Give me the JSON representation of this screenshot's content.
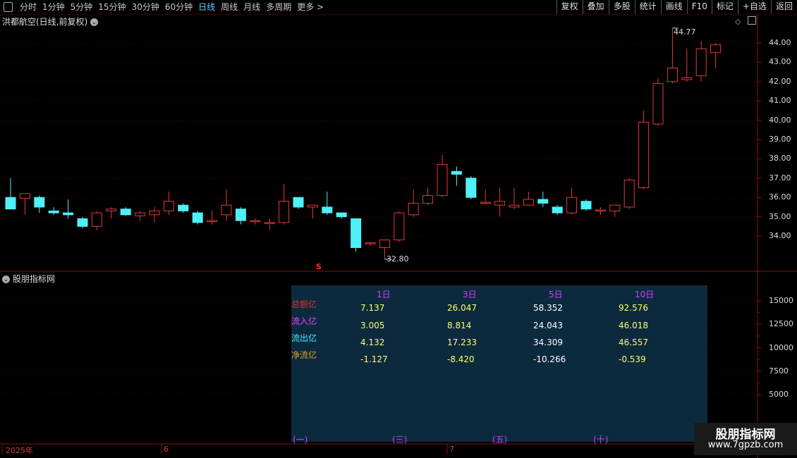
{
  "toolbar": {
    "periods": [
      "分时",
      "1分钟",
      "5分钟",
      "15分钟",
      "30分钟",
      "60分钟",
      "日线",
      "周线",
      "月线",
      "多周期",
      "更多 >"
    ],
    "active_period": "日线",
    "buttons": [
      "复权",
      "叠加",
      "多股",
      "统计",
      "画线",
      "F10",
      "标记",
      "+自选",
      "返回"
    ]
  },
  "stock_title": "洪都航空(日线,前复权)",
  "indicator_title": "股朋指标网",
  "price_axis": [
    "44.00",
    "43.00",
    "42.00",
    "41.00",
    "40.00",
    "39.00",
    "38.00",
    "37.00",
    "36.00",
    "35.00",
    "34.00"
  ],
  "volume_axis": [
    "15000",
    "12500",
    "10000",
    "7500",
    "5000"
  ],
  "annotations": {
    "high": "44.77",
    "low": "32.80",
    "signal": "S"
  },
  "date_labels": [
    "2025年",
    "6",
    "7"
  ],
  "table": {
    "headers": [
      "1日",
      "3日",
      "5日",
      "10日"
    ],
    "rows": [
      {
        "label": "总额亿",
        "color": "#e03030",
        "values": [
          "7.137",
          "26.047",
          "58.352",
          "92.576"
        ]
      },
      {
        "label": "流入亿",
        "color": "#ff3cff",
        "values": [
          "3.005",
          "8.814",
          "24.043",
          "46.018"
        ]
      },
      {
        "label": "流出亿",
        "color": "#3cf0ff",
        "values": [
          "4.132",
          "17.233",
          "34.309",
          "46.557"
        ]
      },
      {
        "label": "净流亿",
        "color": "#e0a020",
        "values": [
          "-1.127",
          "-8.420",
          "-10.266",
          "-0.539"
        ]
      }
    ],
    "group_labels": [
      "(一)",
      "(三)",
      "(五)",
      "(十)"
    ]
  },
  "logo": {
    "line1": "股朋指标网",
    "line2": "www.7gpzb.com"
  },
  "colors": {
    "up": "#e03a3a",
    "down": "#4ff0f8",
    "grid": "#5a0000",
    "total": "#a01010",
    "inflow": "#ff22ff",
    "outflow": "#22f0ff"
  },
  "chart_data": {
    "type": "candlestick",
    "candles": [
      {
        "o": 36.0,
        "h": 37.0,
        "l": 35.8,
        "c": 35.4
      },
      {
        "o": 35.95,
        "h": 36.2,
        "l": 35.1,
        "c": 36.2
      },
      {
        "o": 36.0,
        "h": 36.1,
        "l": 35.2,
        "c": 35.5
      },
      {
        "o": 35.3,
        "h": 35.5,
        "l": 35.1,
        "c": 35.2
      },
      {
        "o": 35.2,
        "h": 35.9,
        "l": 34.9,
        "c": 35.1
      },
      {
        "o": 34.9,
        "h": 35.0,
        "l": 34.4,
        "c": 34.5
      },
      {
        "o": 34.5,
        "h": 35.3,
        "l": 34.3,
        "c": 35.2
      },
      {
        "o": 35.3,
        "h": 35.5,
        "l": 34.9,
        "c": 35.4
      },
      {
        "o": 35.4,
        "h": 35.5,
        "l": 35.05,
        "c": 35.1
      },
      {
        "o": 35.05,
        "h": 35.3,
        "l": 34.8,
        "c": 35.2
      },
      {
        "o": 35.1,
        "h": 35.5,
        "l": 34.7,
        "c": 35.3
      },
      {
        "o": 35.3,
        "h": 36.3,
        "l": 35.1,
        "c": 35.8
      },
      {
        "o": 35.6,
        "h": 35.7,
        "l": 35.2,
        "c": 35.3
      },
      {
        "o": 35.2,
        "h": 35.3,
        "l": 34.6,
        "c": 34.7
      },
      {
        "o": 34.75,
        "h": 35.3,
        "l": 34.6,
        "c": 34.8
      },
      {
        "o": 35.1,
        "h": 36.4,
        "l": 34.8,
        "c": 35.6
      },
      {
        "o": 35.4,
        "h": 35.5,
        "l": 34.6,
        "c": 34.8
      },
      {
        "o": 34.8,
        "h": 34.9,
        "l": 34.6,
        "c": 34.8
      },
      {
        "o": 34.65,
        "h": 34.9,
        "l": 34.3,
        "c": 34.7
      },
      {
        "o": 34.7,
        "h": 36.7,
        "l": 34.6,
        "c": 35.8
      },
      {
        "o": 36.0,
        "h": 36.0,
        "l": 35.4,
        "c": 35.5
      },
      {
        "o": 35.5,
        "h": 35.6,
        "l": 34.9,
        "c": 35.6
      },
      {
        "o": 35.5,
        "h": 36.3,
        "l": 35.1,
        "c": 35.2
      },
      {
        "o": 35.2,
        "h": 35.2,
        "l": 34.9,
        "c": 35.0
      },
      {
        "o": 34.9,
        "h": 34.9,
        "l": 33.2,
        "c": 33.4
      },
      {
        "o": 33.6,
        "h": 33.7,
        "l": 33.5,
        "c": 33.65
      },
      {
        "o": 33.4,
        "h": 33.8,
        "l": 32.8,
        "c": 33.8
      },
      {
        "o": 33.8,
        "h": 35.3,
        "l": 33.7,
        "c": 35.2
      },
      {
        "o": 35.1,
        "h": 36.4,
        "l": 35.0,
        "c": 35.7
      },
      {
        "o": 35.7,
        "h": 36.5,
        "l": 35.6,
        "c": 36.1
      },
      {
        "o": 36.1,
        "h": 38.2,
        "l": 36.0,
        "c": 37.7
      },
      {
        "o": 37.35,
        "h": 37.6,
        "l": 36.6,
        "c": 37.2
      },
      {
        "o": 37.0,
        "h": 37.1,
        "l": 35.9,
        "c": 36.0
      },
      {
        "o": 35.75,
        "h": 36.4,
        "l": 35.7,
        "c": 35.75
      },
      {
        "o": 35.6,
        "h": 36.5,
        "l": 35.0,
        "c": 35.8
      },
      {
        "o": 35.5,
        "h": 36.5,
        "l": 35.4,
        "c": 35.6
      },
      {
        "o": 35.6,
        "h": 36.3,
        "l": 35.6,
        "c": 35.9
      },
      {
        "o": 35.9,
        "h": 36.3,
        "l": 35.5,
        "c": 35.7
      },
      {
        "o": 35.5,
        "h": 35.6,
        "l": 35.1,
        "c": 35.2
      },
      {
        "o": 35.2,
        "h": 36.5,
        "l": 35.1,
        "c": 36.0
      },
      {
        "o": 35.8,
        "h": 35.9,
        "l": 35.3,
        "c": 35.4
      },
      {
        "o": 35.35,
        "h": 35.5,
        "l": 35.1,
        "c": 35.35
      },
      {
        "o": 35.3,
        "h": 35.6,
        "l": 35.0,
        "c": 35.6
      },
      {
        "o": 35.5,
        "h": 37.0,
        "l": 35.4,
        "c": 36.9
      },
      {
        "o": 36.5,
        "h": 40.5,
        "l": 36.4,
        "c": 39.9
      },
      {
        "o": 39.8,
        "h": 42.2,
        "l": 39.7,
        "c": 41.9
      },
      {
        "o": 42.0,
        "h": 44.77,
        "l": 41.9,
        "c": 42.7
      },
      {
        "o": 42.1,
        "h": 43.7,
        "l": 42.0,
        "c": 42.2
      },
      {
        "o": 42.3,
        "h": 44.1,
        "l": 42.0,
        "c": 43.7
      },
      {
        "o": 43.5,
        "h": 44.0,
        "l": 42.7,
        "c": 43.9
      }
    ],
    "ylim": [
      33.0,
      45.0
    ],
    "bars": {
      "groups": [
        "(一)",
        "(三)",
        "(五)",
        "(十)"
      ],
      "total": [
        7.137,
        26.047,
        58.352,
        92.576
      ],
      "inflow": [
        3.005,
        8.814,
        24.043,
        46.018
      ],
      "outflow": [
        4.132,
        17.233,
        34.309,
        46.557
      ],
      "ylim": [
        0,
        17000
      ]
    }
  }
}
